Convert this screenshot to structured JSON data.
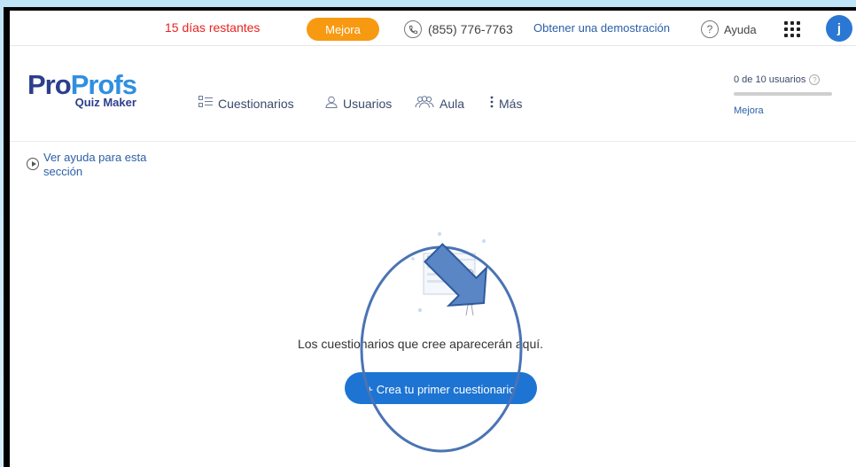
{
  "topbar": {
    "trial_text": "15 días restantes",
    "upgrade_label": "Mejora",
    "phone": "(855) 776-7763",
    "demo_link": "Obtener una demostración",
    "help_label": "Ayuda",
    "avatar_initial": "j"
  },
  "logo": {
    "main_1": "Pro",
    "main_2": "Profs",
    "sub": "Quiz Maker"
  },
  "nav": {
    "quizzes": "Cuestionarios",
    "users": "Usuarios",
    "classroom": "Aula",
    "more": "Más"
  },
  "users_box": {
    "count_text": "0 de 10 usuarios",
    "upgrade_link": "Mejora",
    "usage_fraction": 0
  },
  "help_section": {
    "label_line1": "Ver ayuda para esta",
    "label_line2": "sección"
  },
  "empty_state": {
    "message": "Los cuestionarios que cree aparecerán aquí.",
    "create_button": "+ Crea tu primer cuestionario"
  },
  "colors": {
    "accent_blue": "#1d74d3",
    "upgrade_orange": "#f79a12",
    "trial_red": "#e8231f",
    "annotation_blue": "#4a74b4"
  }
}
